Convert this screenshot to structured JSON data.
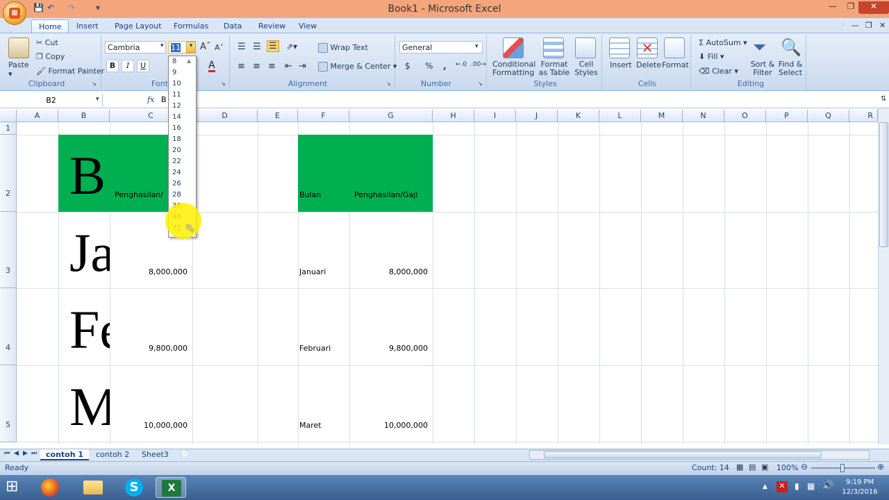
{
  "window": {
    "title": "Book1 - Microsoft Excel"
  },
  "tabs": [
    {
      "label": "Home",
      "active": true
    },
    {
      "label": "Insert"
    },
    {
      "label": "Page Layout"
    },
    {
      "label": "Formulas"
    },
    {
      "label": "Data"
    },
    {
      "label": "Review"
    },
    {
      "label": "View"
    }
  ],
  "clipboard": {
    "paste": "Paste",
    "cut": "Cut",
    "copy": "Copy",
    "format_painter": "Format Painter",
    "label": "Clipboard"
  },
  "font": {
    "name": "Cambria",
    "size": "11",
    "label": "Font",
    "bold": "B",
    "italic": "I",
    "underline": "U"
  },
  "alignment": {
    "wrap": "Wrap Text",
    "merge": "Merge & Center",
    "label": "Alignment"
  },
  "number": {
    "format": "General",
    "currency": "$",
    "percent": "%",
    "comma": ",",
    "label": "Number"
  },
  "styles": {
    "conditional": "Conditional Formatting",
    "as_table": "Format as Table",
    "cell_styles": "Cell Styles",
    "label": "Styles"
  },
  "cells": {
    "insert": "Insert",
    "delete": "Delete",
    "format": "Format",
    "label": "Cells"
  },
  "editing": {
    "autosum": "AutoSum",
    "fill": "Fill",
    "clear": "Clear",
    "sort": "Sort & Filter",
    "find": "Find & Select",
    "label": "Editing"
  },
  "formula_bar": {
    "name_box": "B2",
    "fx": "fx",
    "content": "B"
  },
  "columns": [
    "A",
    "B",
    "C",
    "D",
    "E",
    "F",
    "G",
    "H",
    "I",
    "J",
    "K",
    "L",
    "M",
    "N",
    "O",
    "P",
    "Q",
    "R"
  ],
  "rows": [
    "1",
    "2",
    "3",
    "4",
    "5"
  ],
  "cells_data": {
    "b2": "B",
    "c2": "Penghasilan/",
    "b3": "Ja",
    "c3": "8,000,000",
    "b4": "Fe",
    "c4": "9,800,000",
    "b5": "M",
    "c5": "10,000,000",
    "f2": "Bulan",
    "g2": "Penghasilan/Gaji",
    "f3": "Januari",
    "g3": "8,000,000",
    "f4": "Februari",
    "g4": "9,800,000",
    "f5": "Maret",
    "g5": "10,000,000"
  },
  "font_sizes": [
    "8",
    "9",
    "10",
    "11",
    "12",
    "14",
    "16",
    "18",
    "20",
    "22",
    "24",
    "26",
    "28",
    "36",
    "48",
    "72"
  ],
  "sheets": [
    {
      "label": "contoh 1",
      "active": true
    },
    {
      "label": "contoh 2"
    },
    {
      "label": "Sheet3"
    }
  ],
  "status": {
    "ready": "Ready",
    "count": "Count: 14",
    "zoom": "100%"
  },
  "clock": {
    "time": "9:19 PM",
    "date": "12/3/2016"
  },
  "colors": {
    "green": "#00b050",
    "titlebar": "#f4a57c",
    "highlight": "#fff000"
  }
}
